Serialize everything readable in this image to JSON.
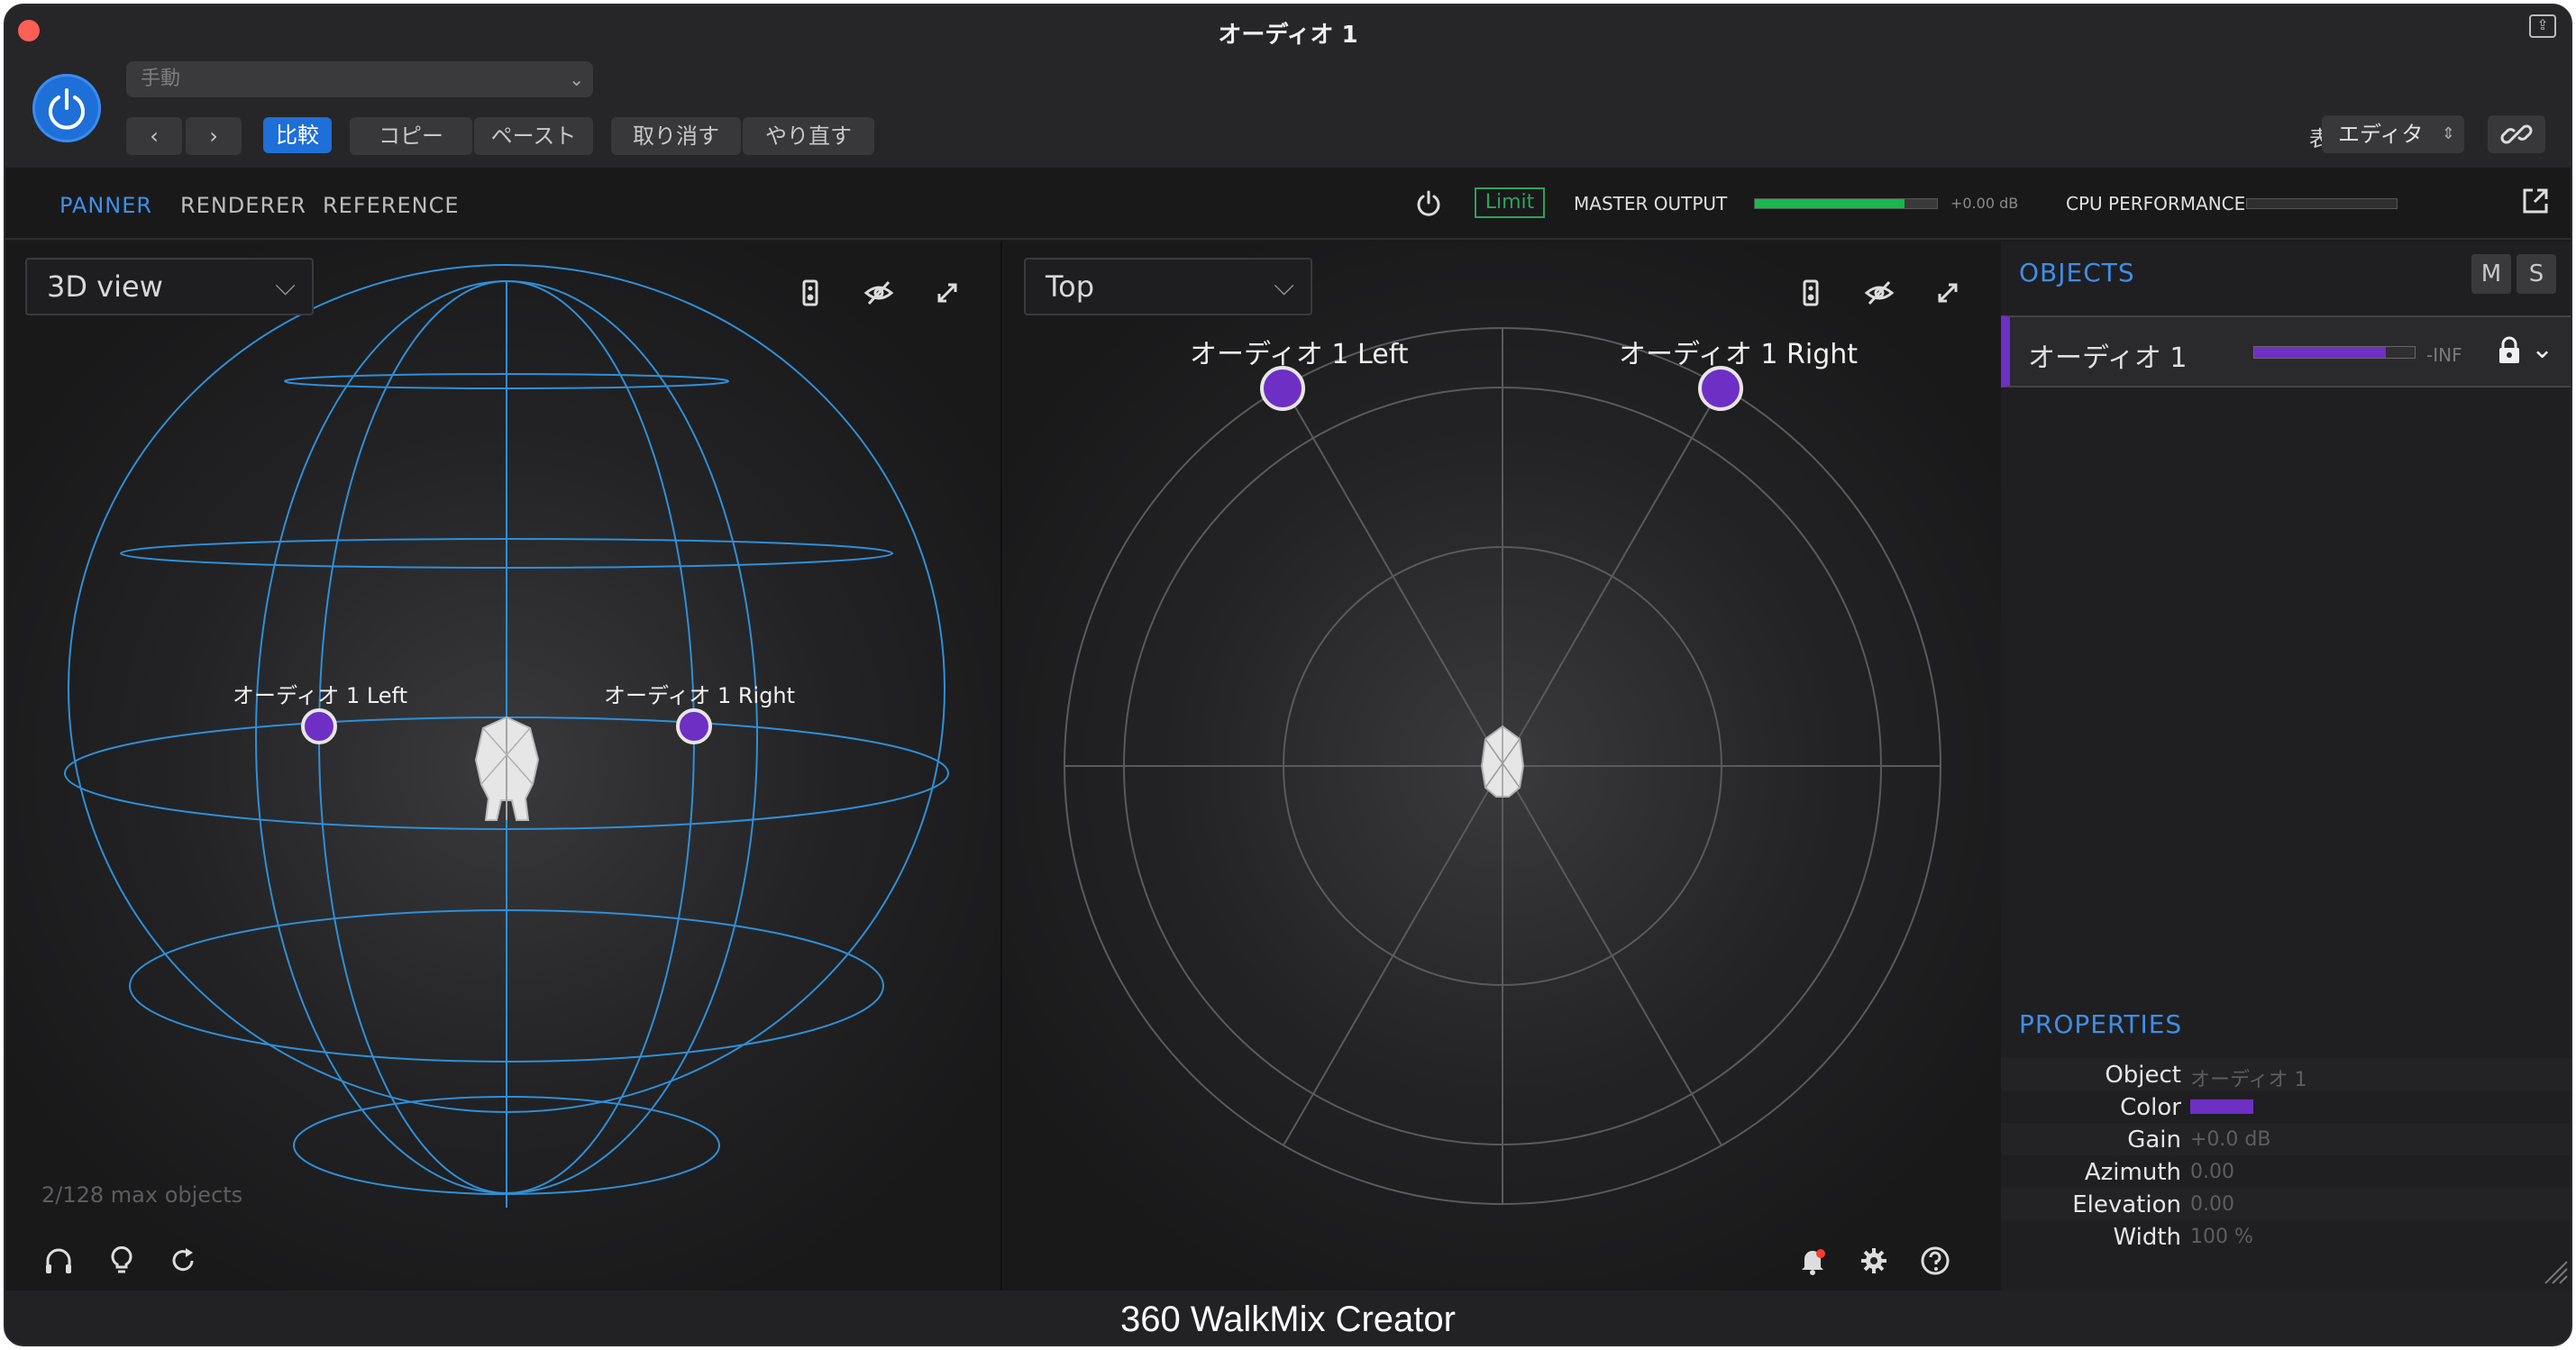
{
  "window": {
    "title": "オーディオ 1"
  },
  "header": {
    "preset_placeholder": "手動",
    "compare_label": "比較",
    "copy_label": "コピー",
    "paste_label": "ペースト",
    "undo_label": "取り消す",
    "redo_label": "やり直す",
    "view_label": "表示:",
    "view_value": "エディタ"
  },
  "toolbar": {
    "tabs": [
      {
        "label": "PANNER",
        "active": true
      },
      {
        "label": "RENDERER",
        "active": false
      },
      {
        "label": "REFERENCE",
        "active": false
      }
    ],
    "limit_label": "Limit",
    "master_output_label": "MASTER OUTPUT",
    "master_output_db": "+0.00 dB",
    "master_output_level": 0.82,
    "cpu_label": "CPU PERFORMANCE",
    "cpu_level": 0.0
  },
  "left_panel": {
    "view_mode": "3D view",
    "max_objects": "2/128 max objects",
    "objects": [
      {
        "label": "オーディオ 1 Left"
      },
      {
        "label": "オーディオ 1 Right"
      }
    ]
  },
  "mid_panel": {
    "view_mode": "Top",
    "objects": [
      {
        "label": "オーディオ 1 Left"
      },
      {
        "label": "オーディオ 1 Right"
      }
    ]
  },
  "sidebar": {
    "objects_title": "OBJECTS",
    "mute_label": "M",
    "solo_label": "S",
    "object_row": {
      "name": "オーディオ 1",
      "level_db": "-INF",
      "meter_level": 0.82
    },
    "properties_title": "PROPERTIES",
    "properties": [
      {
        "key": "Object",
        "value": "オーディオ 1"
      },
      {
        "key": "Color",
        "value": ""
      },
      {
        "key": "Gain",
        "value": "+0.0 dB"
      },
      {
        "key": "Azimuth",
        "value": "0.00"
      },
      {
        "key": "Elevation",
        "value": "0.00"
      },
      {
        "key": "Width",
        "value": "100 %"
      }
    ]
  },
  "colors": {
    "accent": "#3f8ee8",
    "object": "#6e2fc4",
    "meter_green": "#19b84c",
    "sphere": "#2f8fd8"
  },
  "footer": {
    "caption": "360 WalkMix Creator"
  }
}
